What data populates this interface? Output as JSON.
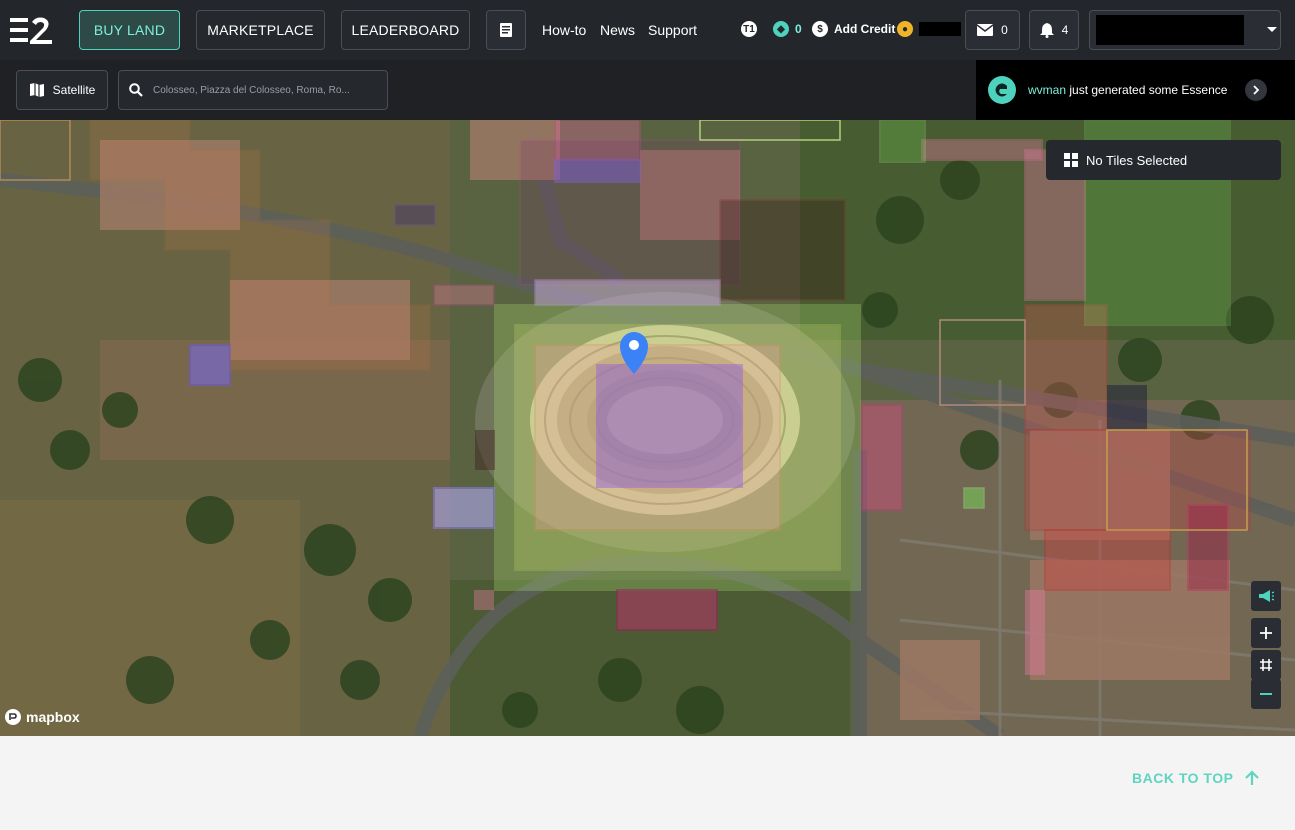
{
  "nav": {
    "buy_land": "BUY LAND",
    "marketplace": "MARKETPLACE",
    "leaderboard": "LEADERBOARD",
    "links": [
      "How-to",
      "News",
      "Support"
    ],
    "t1_label": "T1",
    "essence_count": "0",
    "add_credit": "Add Credit",
    "messages_count": "0",
    "notifications_count": "4",
    "accent_color": "#4fd2bd"
  },
  "toolbar": {
    "satellite_label": "Satellite",
    "search_placeholder": "Colosseo, Piazza del Colosseo, Roma, Ro..."
  },
  "notification": {
    "user": "wvman",
    "message": " just generated some Essence"
  },
  "map": {
    "tiles_panel": "No Tiles Selected",
    "attribution": "mapbox",
    "icons": [
      "megaphone-icon",
      "plus-icon",
      "grid-icon",
      "minus-icon"
    ]
  },
  "footer": {
    "back_to_top": "BACK TO TOP"
  }
}
